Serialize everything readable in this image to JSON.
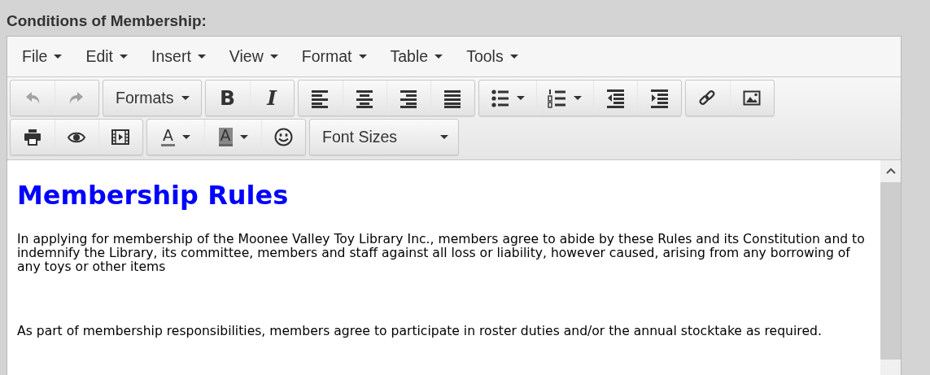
{
  "label": "Conditions of Membership:",
  "menubar": [
    {
      "label": "File"
    },
    {
      "label": "Edit"
    },
    {
      "label": "Insert"
    },
    {
      "label": "View"
    },
    {
      "label": "Format"
    },
    {
      "label": "Table"
    },
    {
      "label": "Tools"
    }
  ],
  "toolbar_rows": [
    [
      [
        {
          "kind": "undo",
          "disabled": true
        },
        {
          "kind": "redo",
          "disabled": true
        }
      ],
      [
        {
          "label": "Formats",
          "kind": "dropdown"
        }
      ],
      [
        {
          "label": "B",
          "kind": "bold"
        },
        {
          "label": "I",
          "kind": "italic"
        }
      ],
      [
        {
          "kind": "align-left"
        },
        {
          "kind": "align-center"
        },
        {
          "kind": "align-right"
        },
        {
          "kind": "justify"
        }
      ],
      [
        {
          "kind": "bullet-list"
        },
        {
          "kind": "numbered-list"
        },
        {
          "kind": "outdent"
        },
        {
          "kind": "indent"
        }
      ],
      [
        {
          "kind": "link"
        },
        {
          "kind": "image"
        }
      ]
    ],
    [
      [
        {
          "kind": "print"
        },
        {
          "kind": "eye"
        },
        {
          "kind": "film"
        }
      ],
      [
        {
          "label": "A",
          "kind": "text-color"
        },
        {
          "label": "A",
          "kind": "background-color"
        },
        {
          "kind": "smiley"
        }
      ],
      [
        {
          "label": "Font Sizes",
          "kind": "wide-dropdown"
        }
      ]
    ]
  ],
  "content": {
    "heading": "Membership Rules",
    "paragraphs": [
      "In applying for membership of the Moonee Valley Toy Library Inc., members agree to abide by these Rules and its Constitution and to indemnify the Library, its committee, members and staff against all loss or liability, however caused, arising from any borrowing of any toys or other items",
      "As part of membership responsibilities, members agree to participate in roster duties and/or the annual stocktake as required."
    ]
  }
}
